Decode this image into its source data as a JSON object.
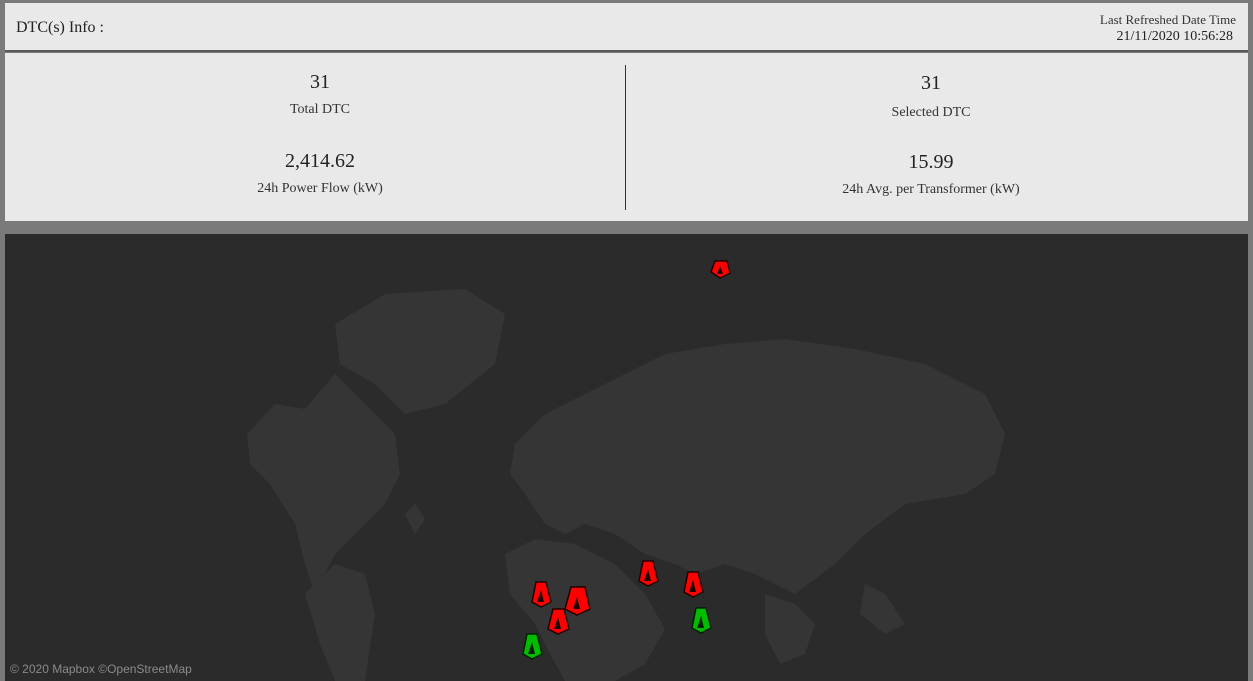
{
  "header": {
    "title": "DTC(s) Info :",
    "refresh_label": "Last Refreshed Date Time",
    "refresh_value": "21/11/2020 10:56:28"
  },
  "stats": {
    "total_dtc": {
      "value": "31",
      "label": "Total DTC"
    },
    "selected_dtc": {
      "value": "31",
      "label": "Selected DTC"
    },
    "power_flow": {
      "value": "2,414.62",
      "label": "24h Power Flow (kW)"
    },
    "avg_per_transformer": {
      "value": "15.99",
      "label": "24h Avg. per Transformer (kW)"
    }
  },
  "map": {
    "attribution": "© 2020 Mapbox ©OpenStreetMap",
    "colors": {
      "background": "#2b2b2b",
      "land": "#353535",
      "alert": "#ff0000",
      "ok": "#00bb00"
    },
    "markers": [
      {
        "status": "alert",
        "icon": "transformer-marker-icon"
      },
      {
        "status": "alert",
        "icon": "transformer-marker-icon"
      },
      {
        "status": "alert",
        "icon": "transformer-marker-icon"
      },
      {
        "status": "alert",
        "icon": "transformer-marker-icon"
      },
      {
        "status": "alert",
        "icon": "transformer-marker-icon"
      },
      {
        "status": "alert",
        "icon": "transformer-marker-icon"
      },
      {
        "status": "ok",
        "icon": "transformer-marker-icon"
      },
      {
        "status": "ok",
        "icon": "transformer-marker-icon"
      }
    ]
  }
}
